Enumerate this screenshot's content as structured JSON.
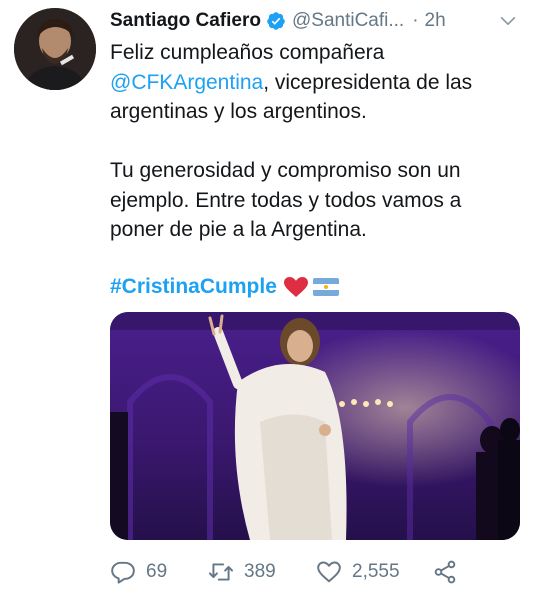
{
  "tweet": {
    "author_name": "Santiago Cafiero",
    "handle": "@SantiCafi...",
    "separator": "·",
    "time": "2h",
    "line1": "Feliz cumpleaños compañera",
    "mention": "@CFKArgentina",
    "line2_rest": ", vicepresidenta de las",
    "line3": "argentinas y los argentinos.",
    "line4": "Tu generosidad y compromiso son un",
    "line5": "ejemplo. Entre todas y todos vamos a",
    "line6": "poner de pie a la Argentina.",
    "hashtag": "#CristinaCumple"
  },
  "actions": {
    "replies": "69",
    "retweets": "389",
    "likes": "2,555"
  },
  "icons": {
    "verified": "verified-badge-icon",
    "chevron": "chevron-down-icon",
    "heart_emoji": "red-heart-emoji",
    "flag_emoji": "argentina-flag-emoji",
    "reply": "reply-icon",
    "retweet": "retweet-icon",
    "like": "like-icon",
    "share": "share-icon"
  },
  "colors": {
    "link": "#1da1f2",
    "text": "#14171a",
    "secondary": "#657786"
  }
}
